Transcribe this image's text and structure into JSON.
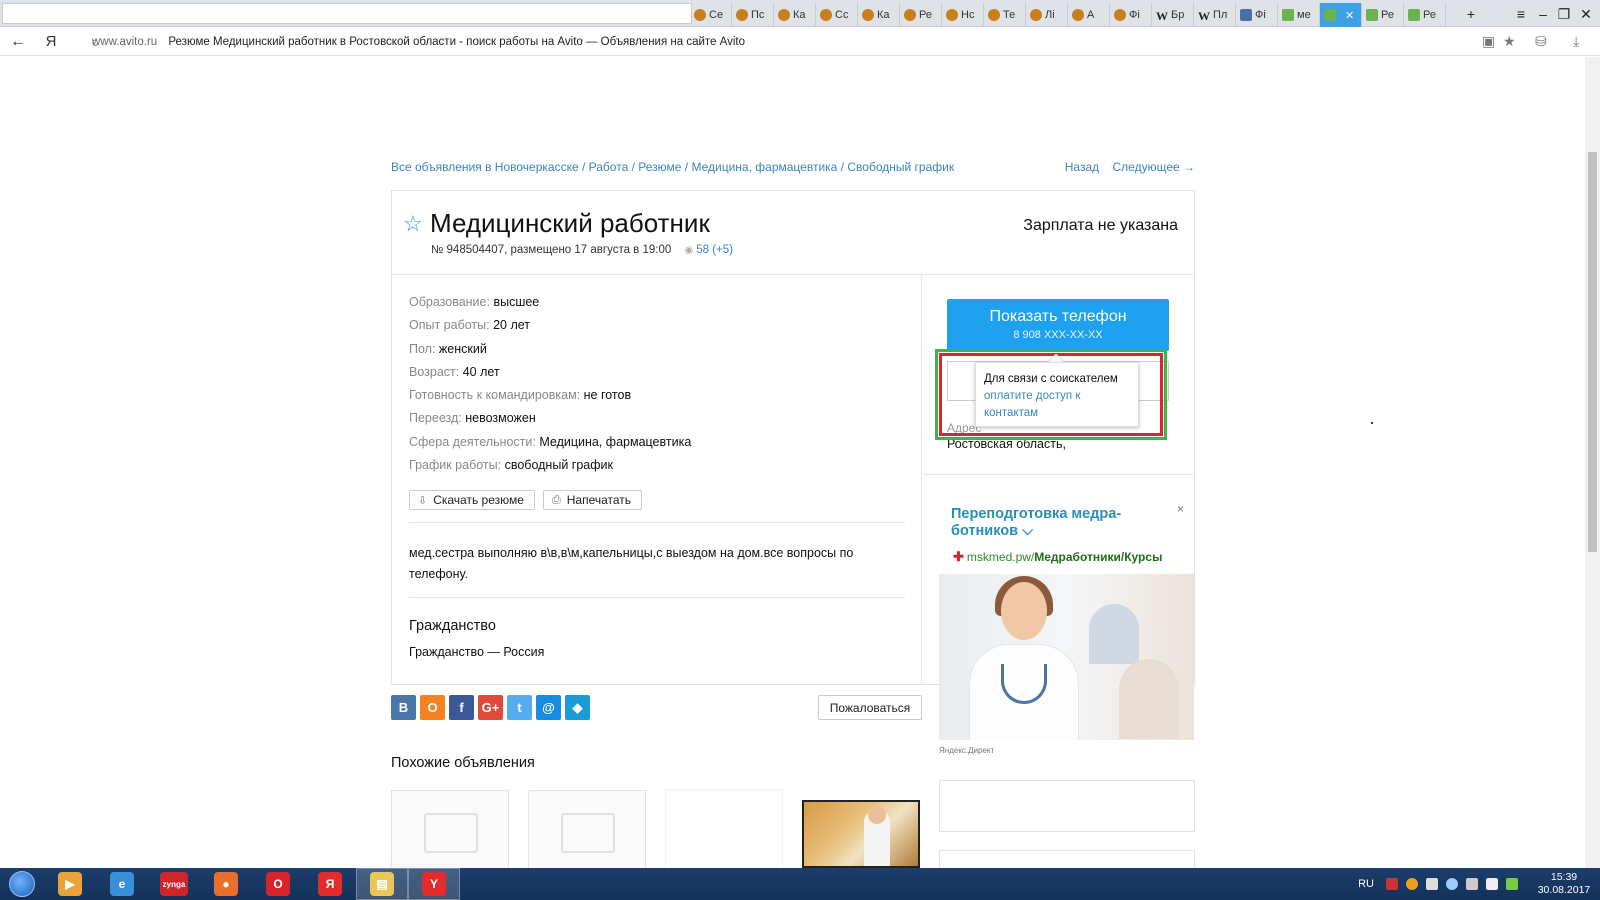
{
  "browser": {
    "tabs": [
      {
        "label": "Се",
        "icon": "orange-coin-icon"
      },
      {
        "label": "Пс",
        "icon": "orange-coin-icon"
      },
      {
        "label": "Ка",
        "icon": "orange-coin-icon"
      },
      {
        "label": "Сс",
        "icon": "orange-coin-icon"
      },
      {
        "label": "Ка",
        "icon": "orange-coin-icon"
      },
      {
        "label": "Ре",
        "icon": "orange-coin-icon"
      },
      {
        "label": "Нс",
        "icon": "orange-coin-icon"
      },
      {
        "label": "Те",
        "icon": "orange-coin-icon"
      },
      {
        "label": "Лі",
        "icon": "orange-coin-icon"
      },
      {
        "label": "А",
        "icon": "orange-coin-icon"
      },
      {
        "label": "Фі",
        "icon": "orange-coin-icon"
      },
      {
        "label": "Бр",
        "icon": "wikipedia-icon"
      },
      {
        "label": "Пл",
        "icon": "wikipedia-icon"
      },
      {
        "label": "Фі",
        "icon": "blue-icon"
      },
      {
        "label": "ме",
        "icon": "green-icon"
      },
      {
        "label": "",
        "icon": "green-icon",
        "active": true
      },
      {
        "label": "Ре",
        "icon": "green-icon"
      },
      {
        "label": "Ре",
        "icon": "green-icon"
      }
    ],
    "new_tab": "+",
    "nav_back": "←",
    "yandex_button": "Я",
    "reload": "c",
    "url_host": "www.avito.ru",
    "page_title": "Резюме Медицинский работник в Ростовской области - поиск работы на Avito — Объявления на сайте Avito"
  },
  "page": {
    "breadcrumb": [
      "Все объявления в Новочеркасске",
      "Работа",
      "Резюме",
      "Медицина, фармацевтика",
      "Свободный график"
    ],
    "breadcrumb_sep": " / ",
    "nav_back": "Назад",
    "nav_next": "Следующее →",
    "title": "Медицинский работник",
    "meta": "№ 948504407, размещено 17 августа в 19:00",
    "views": "58 (+5)",
    "salary": "Зарплата не указана",
    "props": [
      {
        "key": "Образование:",
        "value": "высшее"
      },
      {
        "key": "Опыт работы:",
        "value": "20 лет"
      },
      {
        "key": "Пол:",
        "value": "женский"
      },
      {
        "key": "Возраст:",
        "value": "40 лет"
      },
      {
        "key": "Готовность к командировкам:",
        "value": "не готов"
      },
      {
        "key": "Переезд:",
        "value": "невозможен"
      },
      {
        "key": "Сфера деятельности:",
        "value": "Медицина, фармацевтика"
      },
      {
        "key": "График работы:",
        "value": "свободный график"
      }
    ],
    "download_button": "Скачать резюме",
    "print_button": "Напечатать",
    "description": "мед.сестра выполняю в\\в,в\\м,капельницы,с выездом на дом.все вопросы по телефону.",
    "citizenship_title": "Гражданство",
    "citizenship_text": "Гражданство — Россия",
    "phone_button": "Показать телефон",
    "phone_number": "8 908 XXX-XX-XX",
    "address_label": "Адрес",
    "address_value": "Ростовская область,",
    "tooltip_text": "Для связи с соискателем",
    "tooltip_link": "оплатите доступ к контактам",
    "share": [
      {
        "label": "В",
        "color": "#4a76a8"
      },
      {
        "label": "О",
        "color": "#f58220"
      },
      {
        "label": "f",
        "color": "#3b5998"
      },
      {
        "label": "G+",
        "color": "#dd4b39"
      },
      {
        "label": "t",
        "color": "#55acee"
      },
      {
        "label": "@",
        "color": "#168de2"
      },
      {
        "label": "◆",
        "color": "#1a9ad6"
      }
    ],
    "complain_button": "Пожаловаться",
    "similar_title": "Похожие объявления"
  },
  "ad": {
    "title": "Переподготовка медра-ботников",
    "chevron": "⌵",
    "close": "×",
    "url_host": "mskmed.pw/",
    "url_path": "Медработники/Курсы",
    "source": "Яндекс.Директ"
  },
  "taskbar": {
    "lang": "RU",
    "time": "15:39",
    "date": "30.08.2017",
    "apps": [
      {
        "name": "media-player",
        "label": "▶",
        "color": "#e8a33a"
      },
      {
        "name": "internet-explorer",
        "label": "e",
        "color": "#3a8fdc"
      },
      {
        "name": "zynga",
        "label": "zynga",
        "color": "#d1232a"
      },
      {
        "name": "firefox",
        "label": "●",
        "color": "#e8702a"
      },
      {
        "name": "opera",
        "label": "O",
        "color": "#d8232a"
      },
      {
        "name": "yandex",
        "label": "Я",
        "color": "#e32b2b"
      },
      {
        "name": "explorer",
        "label": "▤",
        "color": "#e8c65a"
      },
      {
        "name": "yandex-browser",
        "label": "Y",
        "color": "#e32b2b"
      }
    ]
  }
}
